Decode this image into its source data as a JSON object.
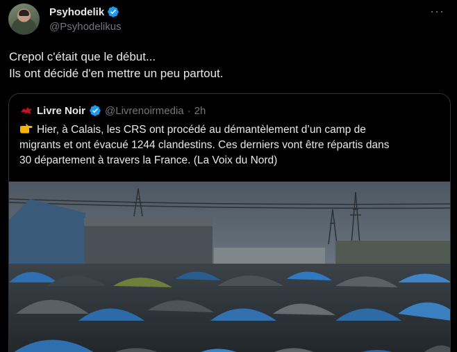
{
  "post": {
    "author_name": "Psyhodelik",
    "author_handle": "@Psyhodelikus",
    "more_label": "···",
    "text_line1": "Crepol c'était que le début...",
    "text_line2": "Ils ont décidé d'en mettre un peu partout."
  },
  "quote": {
    "author_name": "Livre Noir",
    "author_handle": "@Livrenoirmedia",
    "separator": "·",
    "time": "2h",
    "text_line1": "Hier, à Calais, les CRS ont procédé au démantèlement d’un camp de",
    "text_line2": "migrants et ont évacué 1244 clandestins. Ces derniers vont être répartis dans",
    "text_line3": "30 département à travers la France. (La Voix du Nord)"
  },
  "icons": {
    "verified": "verified-badge-icon",
    "pointing": "backhand-index-pointing-right-icon",
    "more": "more-options-icon"
  },
  "colors": {
    "background": "#000000",
    "text": "#e7e9ea",
    "secondary": "#71767b",
    "verified": "#1d9bf0",
    "border": "#2f3336",
    "quote_logo": "#c1121f"
  }
}
